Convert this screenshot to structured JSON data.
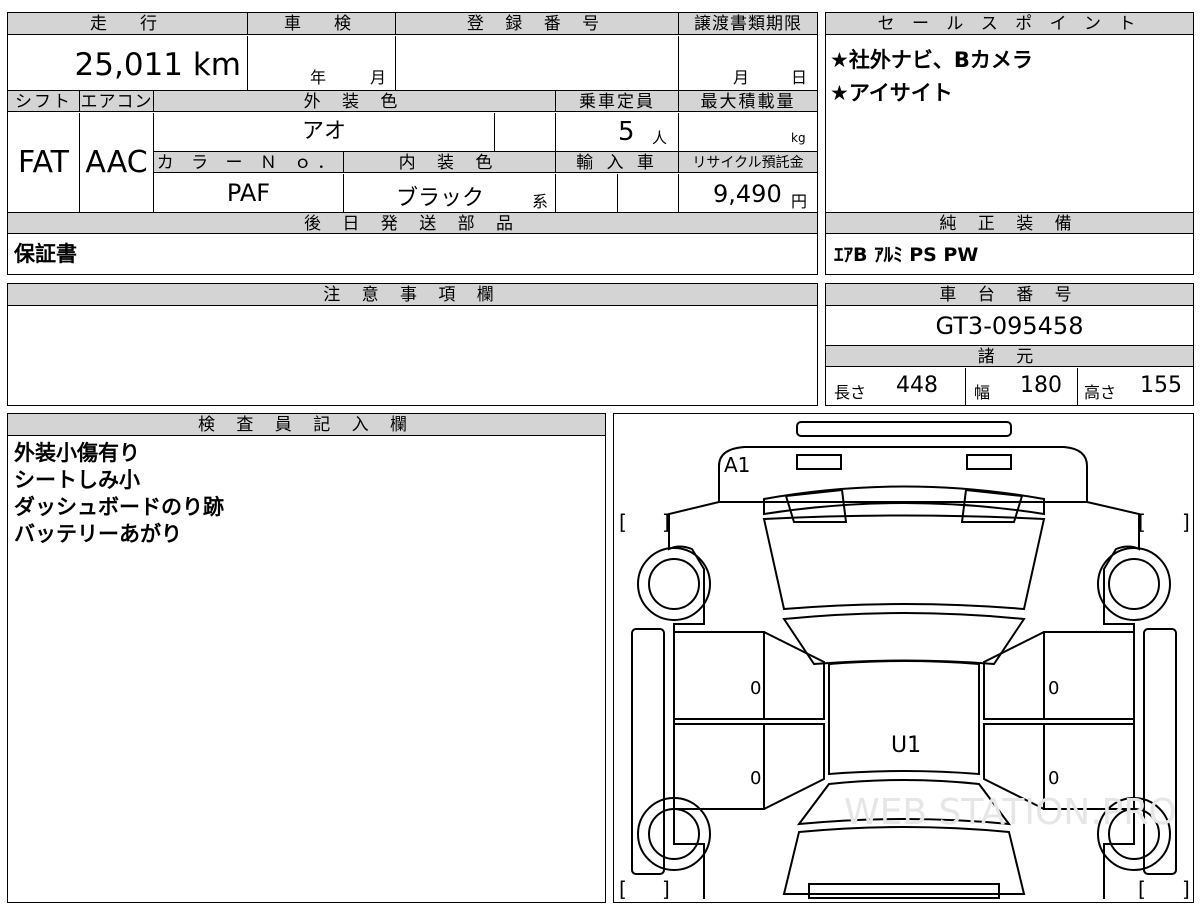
{
  "headers": {
    "mileage": "走　行",
    "inspection": "車　検",
    "registration": "登 録 番 号",
    "transfer_deadline": "譲渡書類期限",
    "shift": "シフト",
    "aircon": "エアコン",
    "exterior_color": "外 装 色",
    "capacity": "乗車定員",
    "max_load": "最大積載量",
    "color_no": "カ ラ ー Ｎ ｏ．",
    "interior_color": "内 装 色",
    "import_car": "輸 入 車",
    "recycle_fee": "リサイクル預託金",
    "later_parts": "後 日 発 送 部 品",
    "sales_points": "セ ー ル ス ポ イ ン ト",
    "genuine_equipment": "純 正 装 備",
    "notes": "注 意 事 項 欄",
    "chassis_no": "車 台 番 号",
    "specs": "諸 元",
    "inspector_notes": "検 査 員 記 入 欄"
  },
  "values": {
    "mileage": "25,011 km",
    "inspection_year_label": "年",
    "inspection_month_label": "月",
    "transfer_month_label": "月",
    "transfer_day_label": "日",
    "shift": "FAT",
    "aircon": "AAC",
    "exterior_color": "アオ",
    "capacity_number": "5",
    "capacity_unit": "人",
    "max_load_unit": "kg",
    "color_no": "PAF",
    "interior_color": "ブラック",
    "interior_suffix": "系",
    "recycle_fee_number": "9,490",
    "recycle_fee_unit": "円",
    "later_parts": "保証書",
    "sales_point_1": "★社外ナビ、Bカメラ",
    "sales_point_2": "★アイサイト",
    "genuine_equipment": "ｴｱB ｱﾙﾐ PS PW",
    "chassis_no": "GT3-095458",
    "length_label": "長さ",
    "length_value": "448",
    "width_label": "幅",
    "width_value": "180",
    "height_label": "高さ",
    "height_value": "155"
  },
  "inspector_lines": [
    "外装小傷有り",
    "シートしみ小",
    "ダッシュボードのり跡",
    "バッテリーあがり"
  ],
  "diagram": {
    "mark_a1": "A1",
    "mark_u1": "U1",
    "zero_mark": "0",
    "bracket_open": "[",
    "bracket_close": "]",
    "watermark": "WEB STATION.PRO"
  }
}
